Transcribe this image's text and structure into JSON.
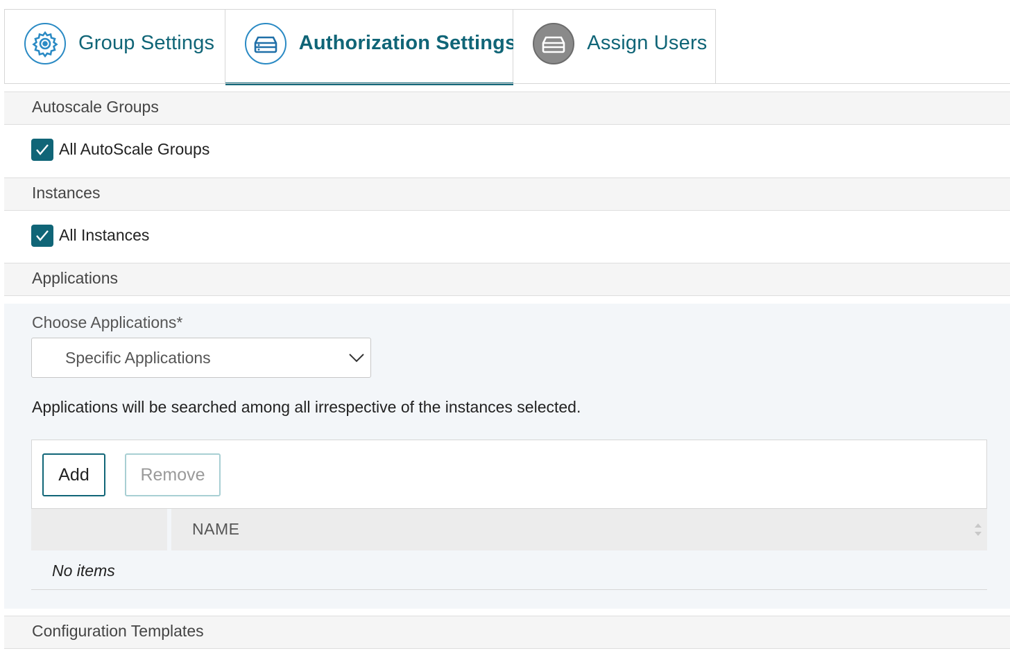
{
  "tabs": [
    {
      "label": "Group Settings",
      "icon": "gear-icon",
      "active": false
    },
    {
      "label": "Authorization Settings",
      "icon": "server-icon",
      "active": true
    },
    {
      "label": "Assign Users",
      "icon": "server-icon",
      "active": false
    }
  ],
  "colors": {
    "accent": "#106577",
    "section_bg": "#f5f5f5",
    "panel_bg": "#f3f6f9"
  },
  "autoscale": {
    "header": "Autoscale Groups",
    "checkbox_label": "All AutoScale Groups",
    "checked": true
  },
  "instances": {
    "header": "Instances",
    "checkbox_label": "All Instances",
    "checked": true
  },
  "applications": {
    "header": "Applications",
    "choose_label": "Choose Applications*",
    "selected_value": "Specific Applications",
    "info_text": "Applications will be searched among all irrespective of the instances selected.",
    "add_label": "Add",
    "remove_label": "Remove",
    "column_name": "NAME",
    "empty_text": "No items"
  },
  "config_templates": {
    "header": "Configuration Templates"
  }
}
